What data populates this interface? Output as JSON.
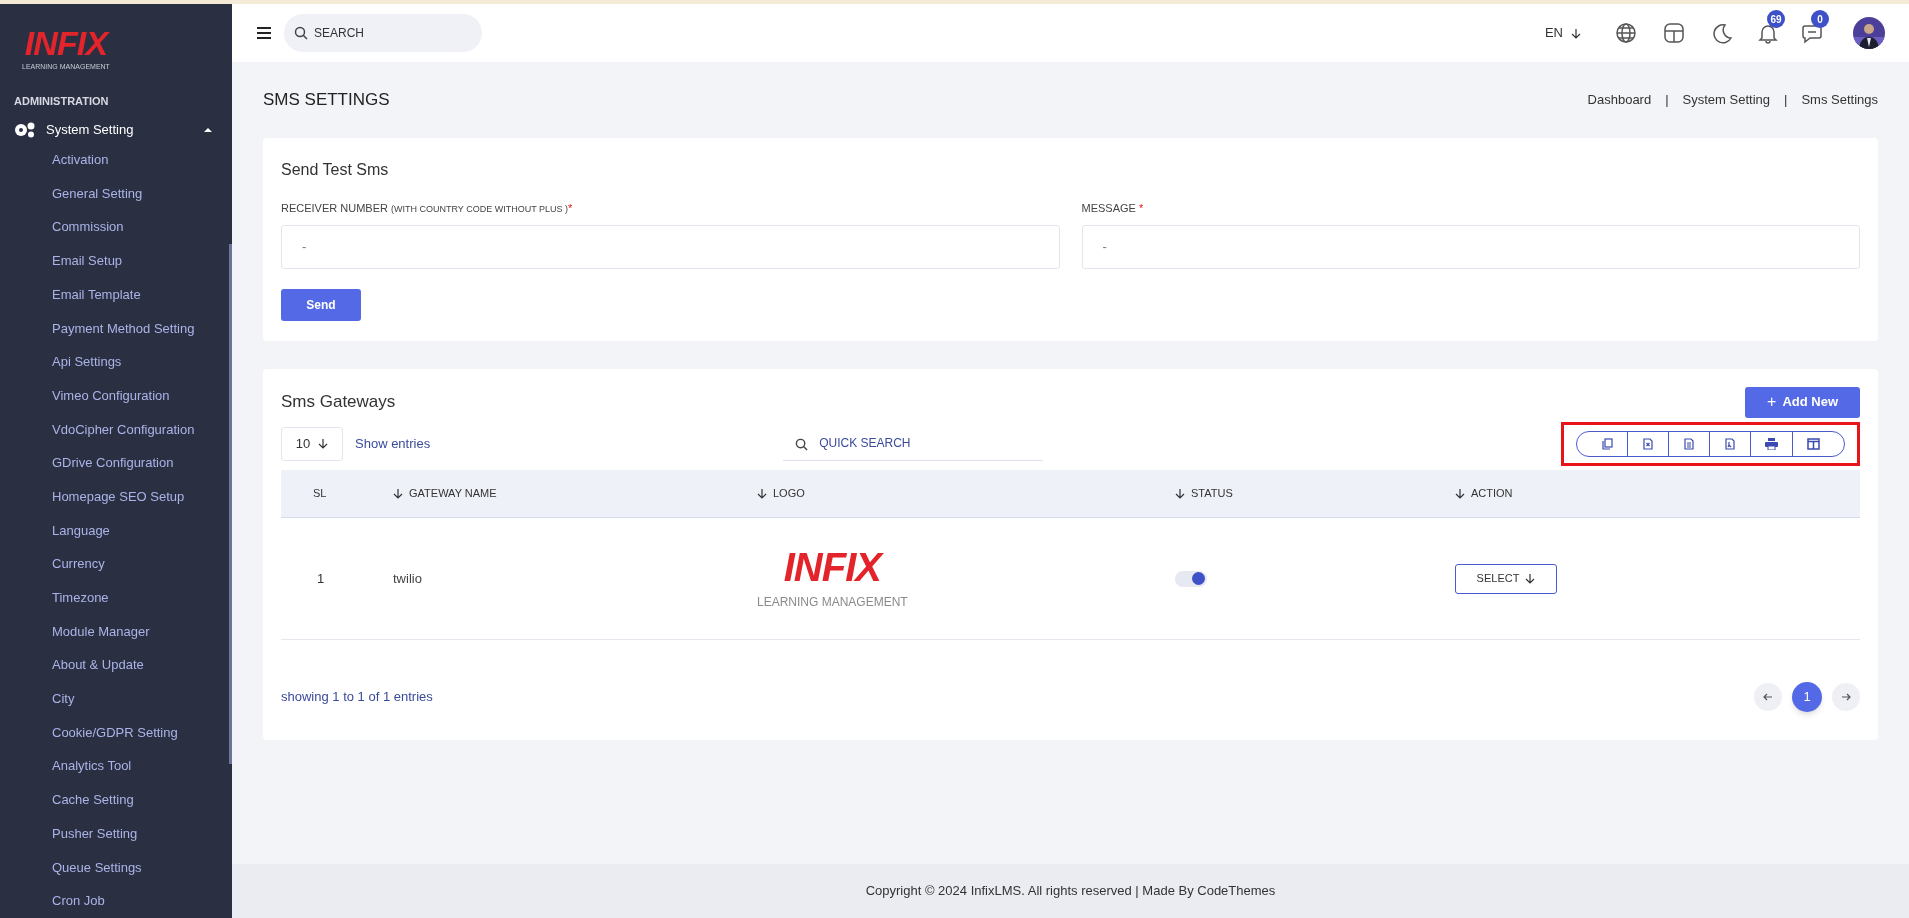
{
  "sidebar": {
    "logo": {
      "word": "INFIX",
      "tagline": "LEARNING MANAGEMENT"
    },
    "section": "ADMINISTRATION",
    "group": {
      "label": "System Setting",
      "expanded": true
    },
    "items": [
      {
        "label": "Activation"
      },
      {
        "label": "General Setting"
      },
      {
        "label": "Commission"
      },
      {
        "label": "Email Setup"
      },
      {
        "label": "Email Template"
      },
      {
        "label": "Payment Method Setting"
      },
      {
        "label": "Api Settings"
      },
      {
        "label": "Vimeo Configuration"
      },
      {
        "label": "VdoCipher Configuration"
      },
      {
        "label": "GDrive Configuration"
      },
      {
        "label": "Homepage SEO Setup"
      },
      {
        "label": "Language"
      },
      {
        "label": "Currency"
      },
      {
        "label": "Timezone"
      },
      {
        "label": "Module Manager"
      },
      {
        "label": "About & Update"
      },
      {
        "label": "City"
      },
      {
        "label": "Cookie/GDPR Setting"
      },
      {
        "label": "Analytics Tool"
      },
      {
        "label": "Cache Setting"
      },
      {
        "label": "Pusher Setting"
      },
      {
        "label": "Queue Settings"
      },
      {
        "label": "Cron Job"
      }
    ]
  },
  "topbar": {
    "search_placeholder": "SEARCH",
    "language": "EN",
    "notifications": "69",
    "messages": "0"
  },
  "page": {
    "title": "SMS SETTINGS",
    "breadcrumbs": [
      "Dashboard",
      "System Setting",
      "Sms Settings"
    ],
    "separator": "|"
  },
  "test_form": {
    "title": "Send Test Sms",
    "receiver_label": "RECEIVER NUMBER",
    "receiver_hint": "(WITH COUNTRY CODE WITHOUT PLUS )",
    "receiver_placeholder": "-",
    "message_label": "MESSAGE",
    "message_placeholder": "-",
    "required_mark": "*",
    "button": "Send"
  },
  "gateways": {
    "title": "Sms Gateways",
    "add_button": "Add New",
    "add_icon": "+",
    "page_size": "10",
    "show_entries": "Show entries",
    "search_placeholder": "QUICK SEARCH",
    "columns": [
      {
        "label": "SL",
        "sortable": false
      },
      {
        "label": "GATEWAY NAME",
        "sortable": true
      },
      {
        "label": "LOGO",
        "sortable": true
      },
      {
        "label": "STATUS",
        "sortable": true
      },
      {
        "label": "ACTION",
        "sortable": true
      }
    ],
    "rows": [
      {
        "sl": "1",
        "name": "twilio",
        "logo": {
          "word": "INFIX",
          "tagline": "LEARNING MANAGEMENT"
        },
        "status_on": true,
        "action": "SELECT"
      }
    ],
    "summary": "showing 1 to 1 of 1 entries",
    "pages": [
      {
        "label": "1",
        "selected": true
      }
    ]
  },
  "footer": "Copyright © 2024 InfixLMS. All rights reserved | Made By CodeThemes"
}
